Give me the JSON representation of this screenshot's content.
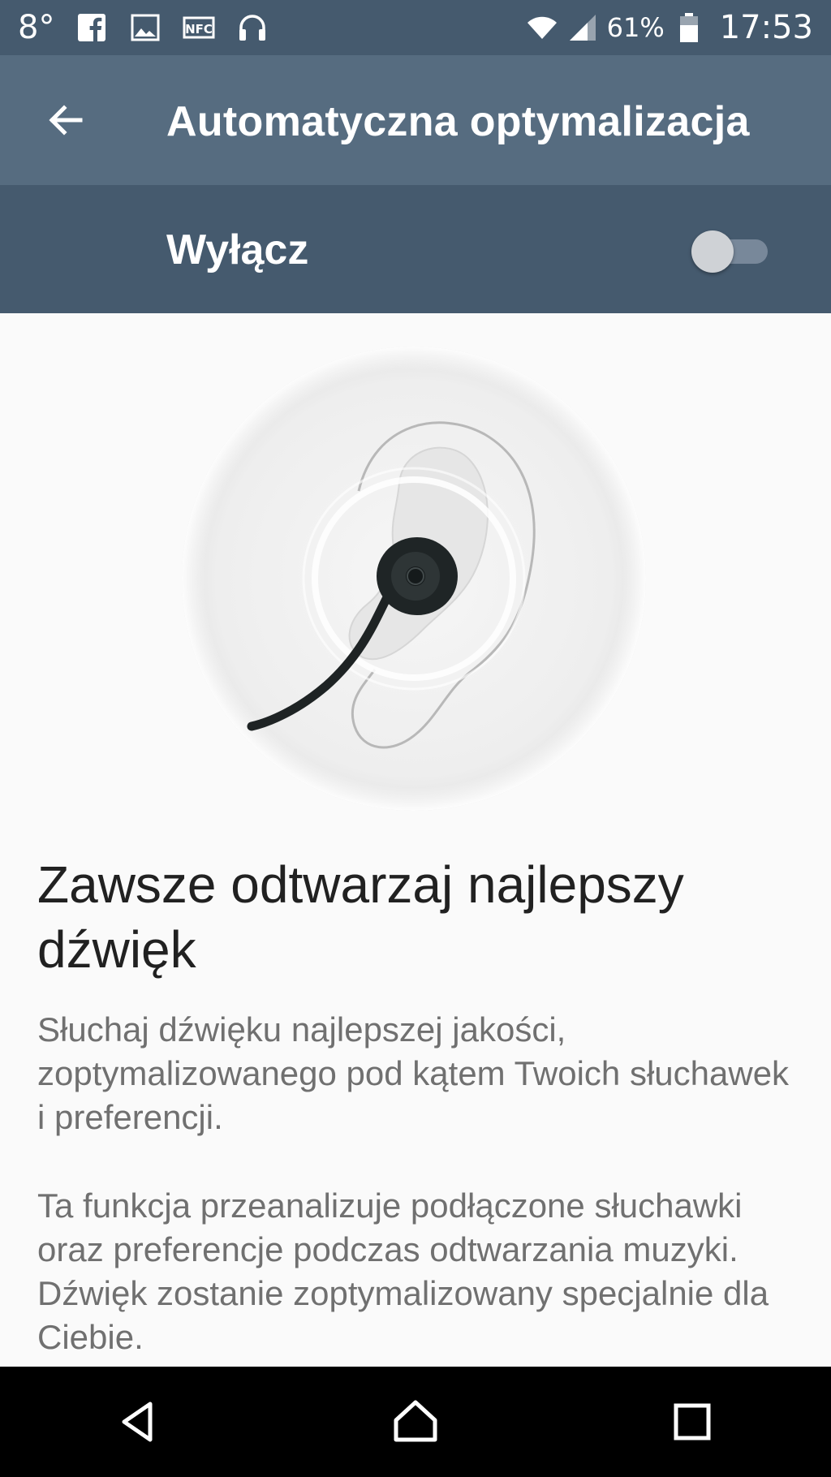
{
  "status_bar": {
    "temperature": "8°",
    "notification_icons": [
      "facebook-icon",
      "gallery-icon",
      "nfc-icon",
      "headphones-icon"
    ],
    "battery_percent": "61%",
    "time": "17:53"
  },
  "app_bar": {
    "title": "Automatyczna optymalizacja"
  },
  "master_switch": {
    "label": "Wyłącz",
    "state": "off"
  },
  "content": {
    "headline": "Zawsze odtwarzaj najlepszy dźwięk",
    "paragraph1": "Słuchaj dźwięku najlepszej jakości, zoptymalizowanego pod kątem Twoich słuchawek i preferencji.",
    "paragraph2": "Ta funkcja przeanalizuje podłączone słuchawki oraz preferencje podczas odtwarzania muzyki. Dźwięk zostanie zoptymalizowany specjalnie dla Ciebie."
  },
  "colors": {
    "status_bar": "#455a6e",
    "app_bar": "#566c80",
    "switch_bar": "#455a6e",
    "background": "#fafafa",
    "headline_text": "#212121",
    "body_text": "#707070"
  },
  "nav_bar": {
    "buttons": [
      "back-icon",
      "home-icon",
      "recents-icon"
    ]
  }
}
